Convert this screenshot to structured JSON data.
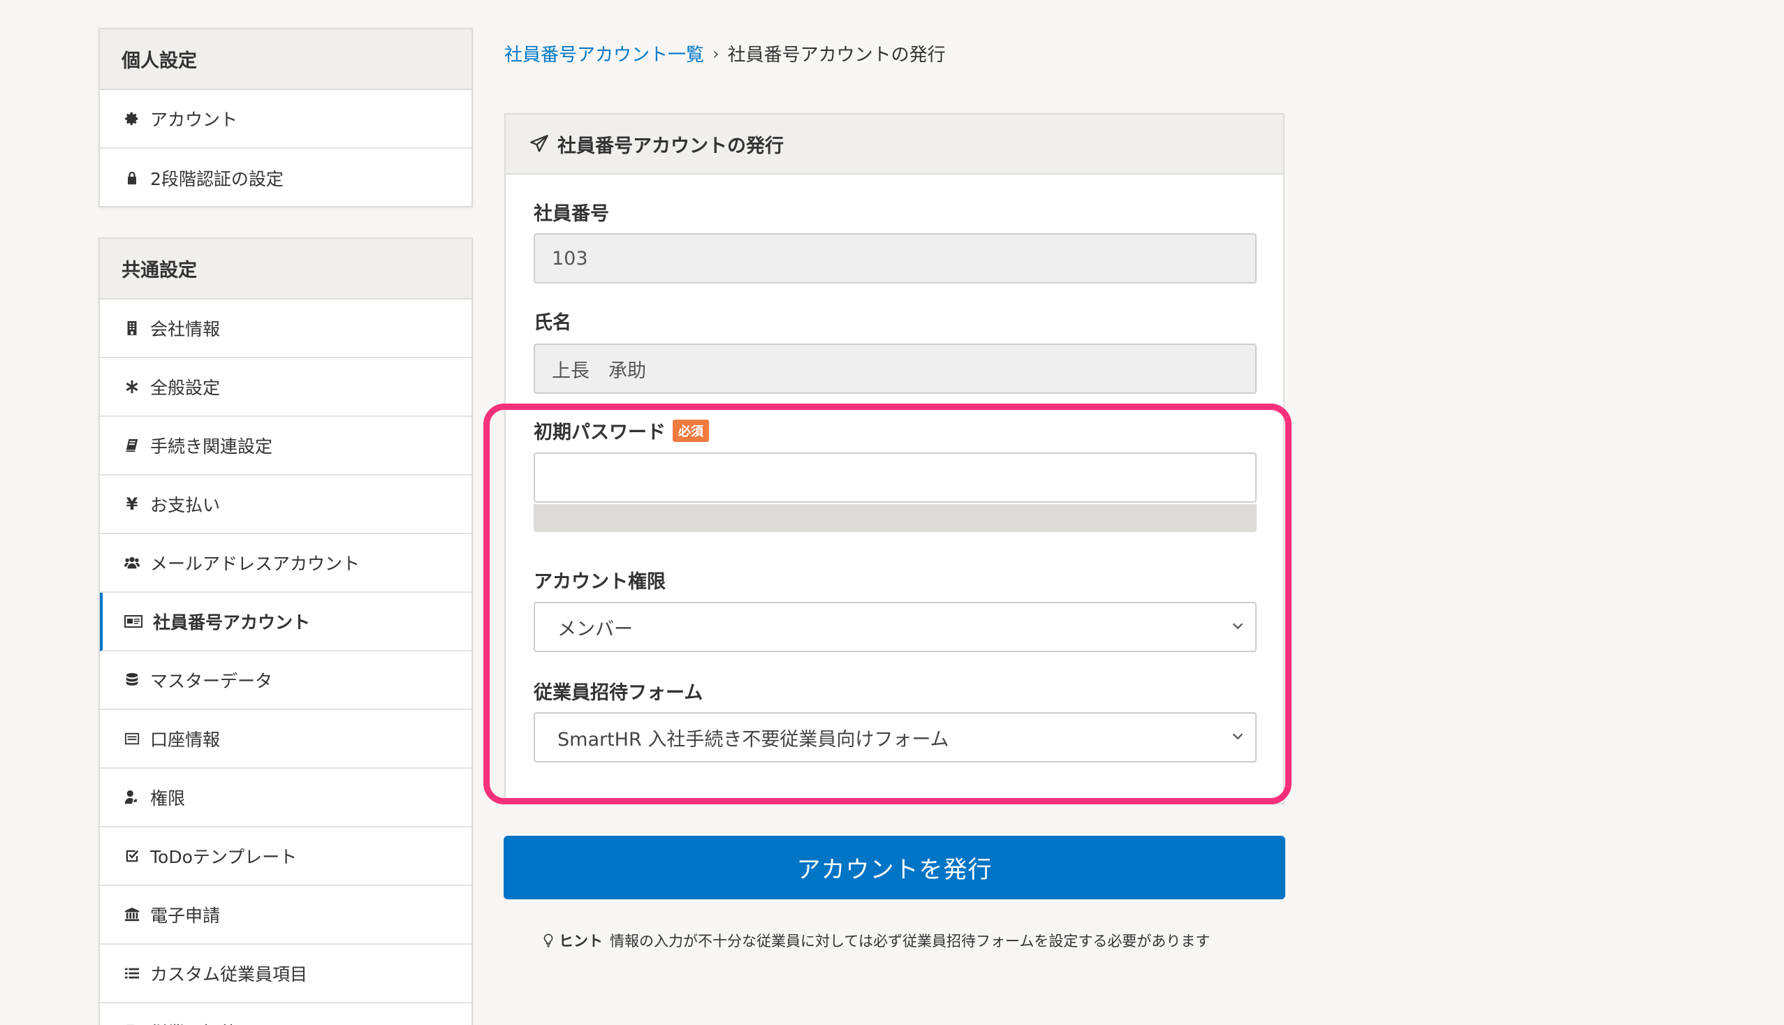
{
  "sidebar": {
    "personal": {
      "title": "個人設定",
      "items": [
        {
          "label": "アカウント",
          "icon": "gear-icon"
        },
        {
          "label": "2段階認証の設定",
          "icon": "lock-icon"
        }
      ]
    },
    "common": {
      "title": "共通設定",
      "items": [
        {
          "label": "会社情報",
          "icon": "building-icon"
        },
        {
          "label": "全般設定",
          "icon": "asterisk-icon"
        },
        {
          "label": "手続き関連設定",
          "icon": "book-icon"
        },
        {
          "label": "お支払い",
          "icon": "yen-icon"
        },
        {
          "label": "メールアドレスアカウント",
          "icon": "users-icon"
        },
        {
          "label": "社員番号アカウント",
          "icon": "id-card-icon",
          "active": true
        },
        {
          "label": "マスターデータ",
          "icon": "database-icon"
        },
        {
          "label": "口座情報",
          "icon": "bank-card-icon"
        },
        {
          "label": "権限",
          "icon": "user-key-icon"
        },
        {
          "label": "ToDoテンプレート",
          "icon": "checkbox-icon"
        },
        {
          "label": "電子申請",
          "icon": "institution-icon"
        },
        {
          "label": "カスタム従業員項目",
          "icon": "list-icon"
        },
        {
          "label": "従業員招待フォーム",
          "icon": "document-icon"
        }
      ]
    }
  },
  "breadcrumb": {
    "parent": "社員番号アカウント一覧",
    "separator": "›",
    "current": "社員番号アカウントの発行"
  },
  "form": {
    "title": "社員番号アカウントの発行",
    "employee_number": {
      "label": "社員番号",
      "value": "103"
    },
    "name": {
      "label": "氏名",
      "value": "上長　承助"
    },
    "initial_password": {
      "label": "初期パスワード",
      "required_badge": "必須",
      "value": ""
    },
    "account_role": {
      "label": "アカウント権限",
      "selected": "メンバー"
    },
    "invite_form": {
      "label": "従業員招待フォーム",
      "selected": "SmartHR 入社手続き不要従業員向けフォーム"
    },
    "submit_label": "アカウントを発行"
  },
  "hint": {
    "title": "ヒント",
    "text": "情報の入力が不十分な従業員に対しては必ず従業員招待フォームを設定する必要があります"
  },
  "colors": {
    "primary": "#0074c5",
    "link": "#0077c7",
    "required": "#f07b3f",
    "highlight": "#f7307a"
  }
}
